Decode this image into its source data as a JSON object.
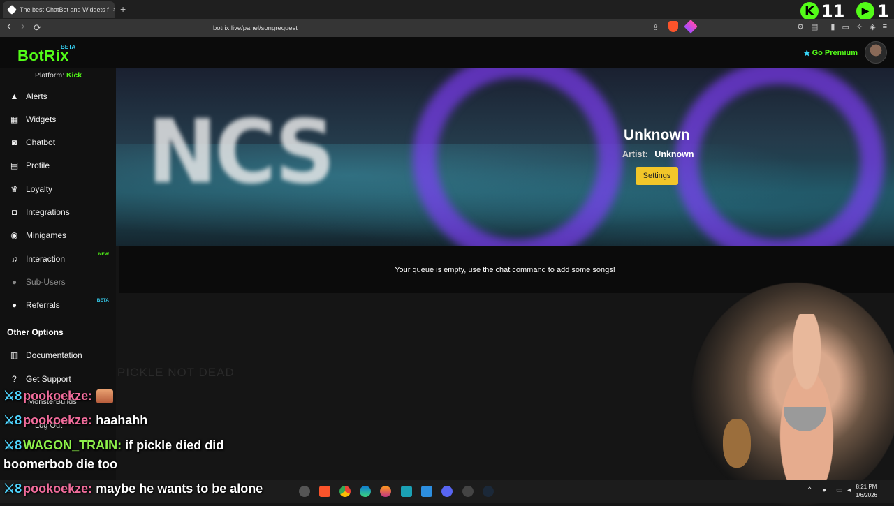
{
  "browser": {
    "tab_title": "The best ChatBot and Widgets f",
    "tab_close": "×",
    "new_tab": "+",
    "url": "botrix.live/panel/songrequest",
    "back": "‹",
    "forward": "›",
    "reload": "⟳"
  },
  "overlay": {
    "kick_count": "11",
    "play_count": "1"
  },
  "app": {
    "brand": "BotRix",
    "brand_badge": "BETA",
    "premium_label": "Go Premium"
  },
  "sidebar": {
    "platform_label": "Platform:",
    "platform_value": "Kick",
    "items": [
      {
        "label": "Alerts",
        "icon": "warning-icon"
      },
      {
        "label": "Widgets",
        "icon": "widgets-icon"
      },
      {
        "label": "Chatbot",
        "icon": "robot-icon"
      },
      {
        "label": "Profile",
        "icon": "id-card-icon"
      },
      {
        "label": "Loyalty",
        "icon": "trophy-icon"
      },
      {
        "label": "Integrations",
        "icon": "integrations-icon"
      },
      {
        "label": "Minigames",
        "icon": "gamepad-icon"
      },
      {
        "label": "Interaction",
        "icon": "music-icon",
        "badge": "NEW"
      },
      {
        "label": "Sub-Users",
        "icon": "users-icon"
      },
      {
        "label": "Referrals",
        "icon": "referrals-icon",
        "badge": "BETA"
      }
    ],
    "other_title": "Other Options",
    "other_items": [
      {
        "label": "Documentation",
        "icon": "scroll-icon"
      },
      {
        "label": "Get Support",
        "icon": "question-icon"
      },
      {
        "label": "MonsterBuilds",
        "icon": "laptop-icon"
      },
      {
        "label": "Log Out",
        "icon": "logout-icon"
      }
    ]
  },
  "player": {
    "cover_text": "NCS",
    "title": "Unknown",
    "artist_label": "Artist:",
    "artist": "Unknown",
    "settings_label": "Settings"
  },
  "queue": {
    "message": "Your queue is empty, use the chat command to add some songs!"
  },
  "stream_overlay": {
    "ghost_text": "PICKLE NOT DEAD",
    "chat": [
      {
        "user": "pookoekze:",
        "message": "",
        "color": "pink",
        "emote": true
      },
      {
        "user": "pookoekze:",
        "message": "haahahh",
        "color": "pink"
      },
      {
        "user": "WAGON_TRAIN:",
        "message": "if pickle died did",
        "color": "green"
      },
      {
        "user": "",
        "message": "boomerbob die too",
        "color": "none"
      },
      {
        "user": "pookoekze:",
        "message": "maybe he wants to be alone",
        "color": "pink"
      }
    ]
  },
  "taskbar": {
    "time": "8:21 PM",
    "date": "1/6/2026"
  },
  "colors": {
    "brand_green": "#53fc18",
    "accent_cyan": "#37d5f7",
    "settings_yellow": "#f2c629",
    "ring_purple": "#8a3cff"
  }
}
